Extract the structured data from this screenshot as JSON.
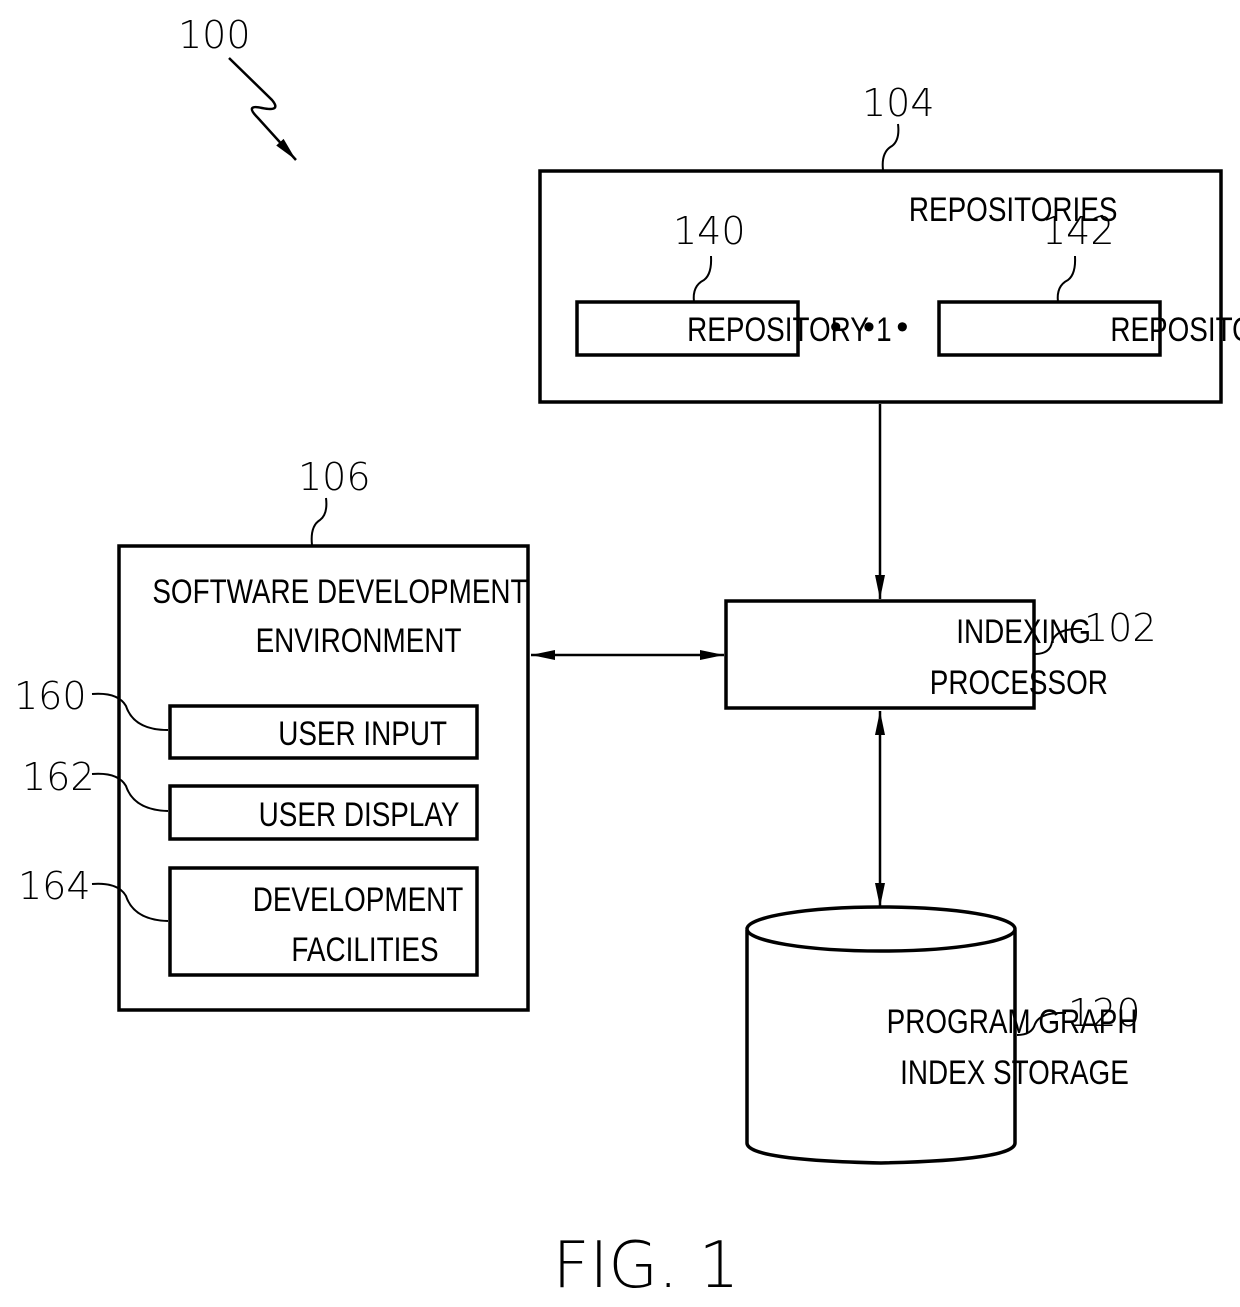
{
  "figure": {
    "caption": "FIG. 1",
    "system_ref": "100"
  },
  "blocks": {
    "repositories": {
      "ref": "104",
      "title": "REPOSITORIES",
      "items": [
        {
          "ref": "140",
          "label": "REPOSITORY 1"
        },
        {
          "ref": "142",
          "label": "REPOSITORY N"
        }
      ],
      "ellipsis": "• • •"
    },
    "indexing_processor": {
      "ref": "102",
      "line1": "INDEXING",
      "line2": "PROCESSOR"
    },
    "software_dev_env": {
      "ref": "106",
      "line1": "SOFTWARE DEVELOPMENT",
      "line2": "ENVIRONMENT",
      "components": [
        {
          "ref": "160",
          "line1": "USER INPUT"
        },
        {
          "ref": "162",
          "line1": "USER DISPLAY"
        },
        {
          "ref": "164",
          "line1": "DEVELOPMENT",
          "line2": "FACILITIES"
        }
      ]
    },
    "storage": {
      "ref": "120",
      "line1": "PROGRAM GRAPH",
      "line2": "INDEX STORAGE"
    }
  },
  "connections": [
    {
      "from": "repositories",
      "to": "indexing_processor",
      "direction": "one-way"
    },
    {
      "from": "software_dev_env",
      "to": "indexing_processor",
      "direction": "two-way"
    },
    {
      "from": "indexing_processor",
      "to": "storage",
      "direction": "two-way"
    }
  ]
}
